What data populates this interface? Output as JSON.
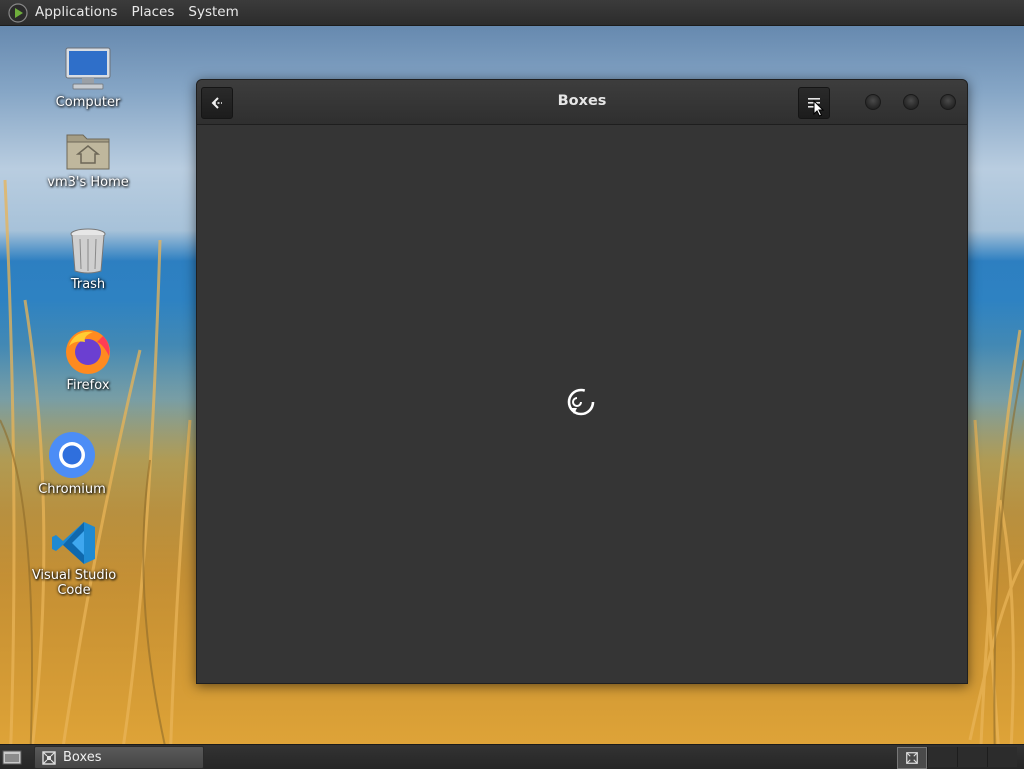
{
  "top_panel": {
    "menus": [
      "Applications",
      "Places",
      "System"
    ]
  },
  "desktop_icons": [
    {
      "label": "Computer",
      "icon": "computer-icon"
    },
    {
      "label": "vm3's Home",
      "icon": "home-folder-icon"
    },
    {
      "label": "Trash",
      "icon": "trash-icon"
    },
    {
      "label": "Firefox",
      "icon": "firefox-icon"
    },
    {
      "label": "Chromium",
      "icon": "chromium-icon"
    },
    {
      "label": "Visual Studio Code",
      "icon": "vscode-icon"
    }
  ],
  "window": {
    "title": "Boxes",
    "state": "loading"
  },
  "taskbar": {
    "tasks": [
      {
        "label": "Boxes",
        "icon": "boxes-icon",
        "active": true
      }
    ]
  },
  "colors": {
    "panel": "#2c2c2c",
    "window_bg": "#353535",
    "titlebar": "#353535",
    "text": "#e6e6e6"
  }
}
